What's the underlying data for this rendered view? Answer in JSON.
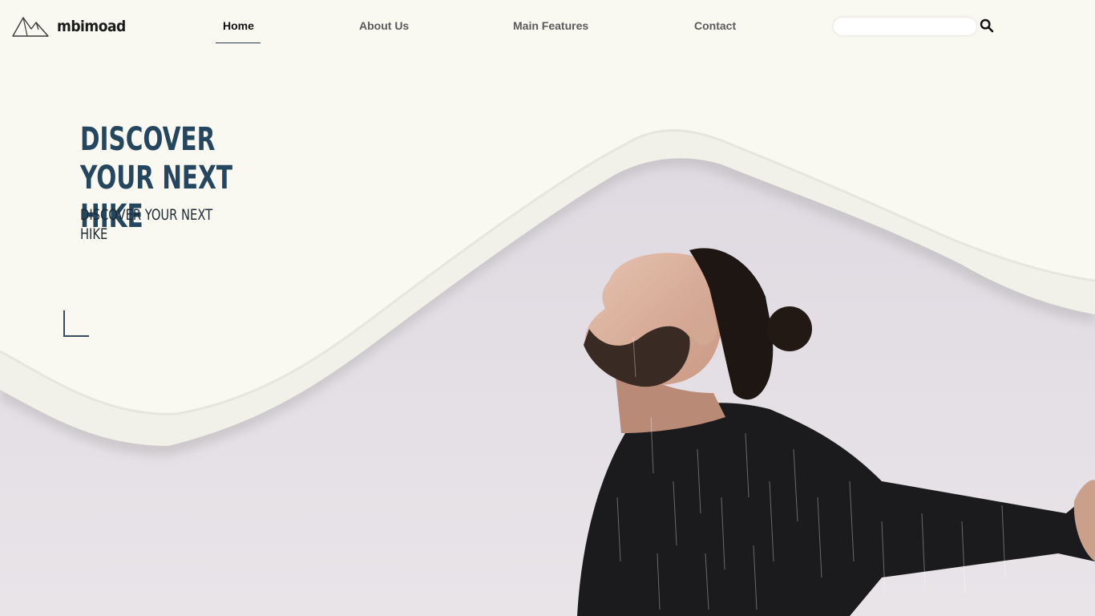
{
  "brand": {
    "name": "mbimoad",
    "icon": "mountain-icon"
  },
  "nav": {
    "items": [
      {
        "label": "Home",
        "active": true
      },
      {
        "label": "About Us",
        "active": false
      },
      {
        "label": "Main Features",
        "active": false
      },
      {
        "label": "Contact",
        "active": false
      }
    ]
  },
  "search": {
    "value": "",
    "placeholder": "",
    "icon": "search-icon"
  },
  "hero": {
    "title": "DISCOVER YOUR NEXT HIKE",
    "subtitle": "DISCOVER YOUR NEXT HIKE",
    "image": "man-with-arms-open-in-rain-photo"
  },
  "colors": {
    "background": "#f9f9f2",
    "title": "#24465e",
    "sky": "#e4e0e6",
    "shirt": "#1a1a1c"
  }
}
